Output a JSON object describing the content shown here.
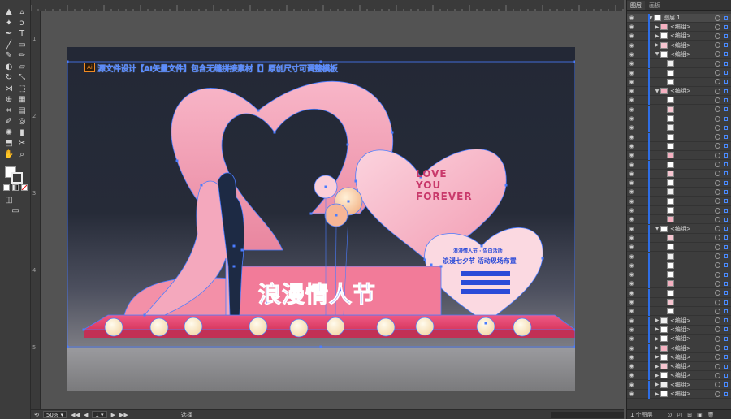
{
  "colors": {
    "accent": "#2e6ee6",
    "heart_pink": "#f4a3b8",
    "stage_pink": "#f0608a",
    "selection_blue": "#4a7cff",
    "artboard_dark": "#232836"
  },
  "toolbar": {
    "tools": [
      {
        "name": "selection-tool-icon",
        "glyph": "▲"
      },
      {
        "name": "direct-selection-tool-icon",
        "glyph": "▵"
      },
      {
        "name": "magic-wand-tool-icon",
        "glyph": "✦"
      },
      {
        "name": "lasso-tool-icon",
        "glyph": "ↄ"
      },
      {
        "name": "pen-tool-icon",
        "glyph": "✒"
      },
      {
        "name": "type-tool-icon",
        "glyph": "T"
      },
      {
        "name": "line-tool-icon",
        "glyph": "╱"
      },
      {
        "name": "rectangle-tool-icon",
        "glyph": "▭"
      },
      {
        "name": "paintbrush-tool-icon",
        "glyph": "✎"
      },
      {
        "name": "pencil-tool-icon",
        "glyph": "✏"
      },
      {
        "name": "blob-brush-tool-icon",
        "glyph": "◐"
      },
      {
        "name": "eraser-tool-icon",
        "glyph": "▱"
      },
      {
        "name": "rotate-tool-icon",
        "glyph": "↻"
      },
      {
        "name": "scale-tool-icon",
        "glyph": "⤡"
      },
      {
        "name": "width-tool-icon",
        "glyph": "⋈"
      },
      {
        "name": "free-transform-tool-icon",
        "glyph": "⬚"
      },
      {
        "name": "shape-builder-tool-icon",
        "glyph": "⊕"
      },
      {
        "name": "perspective-grid-tool-icon",
        "glyph": "▦"
      },
      {
        "name": "mesh-tool-icon",
        "glyph": "⌗"
      },
      {
        "name": "gradient-tool-icon",
        "glyph": "▤"
      },
      {
        "name": "eyedropper-tool-icon",
        "glyph": "✐"
      },
      {
        "name": "blend-tool-icon",
        "glyph": "◎"
      },
      {
        "name": "symbol-sprayer-tool-icon",
        "glyph": "✺"
      },
      {
        "name": "column-graph-tool-icon",
        "glyph": "▮"
      },
      {
        "name": "artboard-tool-icon",
        "glyph": "⬒"
      },
      {
        "name": "slice-tool-icon",
        "glyph": "✂"
      },
      {
        "name": "hand-tool-icon",
        "glyph": "✋"
      },
      {
        "name": "zoom-tool-icon",
        "glyph": "⌕"
      }
    ]
  },
  "ruler": {
    "top": [
      "",
      "",
      "",
      "",
      "",
      "",
      "",
      "",
      "",
      ""
    ],
    "left": [
      "1",
      "2",
      "3",
      "4",
      "5"
    ]
  },
  "artwork": {
    "header_text": "源文件设计【AI矢量文件】包含无缝拼接素材【】原创尺寸可调整模板",
    "ai_badge": "Ai",
    "title": "浪漫情人节",
    "love_lines": [
      "LOVE",
      "YOU",
      "FOREVER"
    ],
    "small_heart_title": "浪漫情人节 · 告白活动",
    "small_heart_subtitle": "浪漫七夕节  活动现场布置",
    "list_items": [
      "",
      "",
      ""
    ]
  },
  "statusbar": {
    "zoom": "50%",
    "artboard": "1",
    "tool_label": "选择"
  },
  "layers_panel": {
    "tabs": [
      "图层",
      "画板"
    ],
    "top_layer": "图层 1",
    "rows": [
      {
        "label": "<编组>",
        "indent": 0,
        "open": false
      },
      {
        "label": "<编组>",
        "indent": 0,
        "open": false
      },
      {
        "label": "<编组>",
        "indent": 0,
        "open": false
      },
      {
        "label": "<编组>",
        "indent": 0,
        "open": true
      },
      {
        "label": "",
        "indent": 1,
        "open": false
      },
      {
        "label": "",
        "indent": 1,
        "open": false
      },
      {
        "label": "",
        "indent": 1,
        "open": false
      },
      {
        "label": "<编组>",
        "indent": 0,
        "open": true
      },
      {
        "label": "",
        "indent": 1,
        "open": false
      },
      {
        "label": "",
        "indent": 1,
        "open": false
      },
      {
        "label": "",
        "indent": 1,
        "open": false
      },
      {
        "label": "",
        "indent": 1,
        "open": false
      },
      {
        "label": "",
        "indent": 1,
        "open": false
      },
      {
        "label": "",
        "indent": 1,
        "open": false
      },
      {
        "label": "",
        "indent": 1,
        "open": false
      },
      {
        "label": "",
        "indent": 1,
        "open": false
      },
      {
        "label": "",
        "indent": 1,
        "open": false
      },
      {
        "label": "",
        "indent": 1,
        "open": false
      },
      {
        "label": "",
        "indent": 1,
        "open": false
      },
      {
        "label": "",
        "indent": 1,
        "open": false
      },
      {
        "label": "",
        "indent": 1,
        "open": false
      },
      {
        "label": "",
        "indent": 1,
        "open": false
      },
      {
        "label": "<编组>",
        "indent": 0,
        "open": true
      },
      {
        "label": "",
        "indent": 1,
        "open": false
      },
      {
        "label": "",
        "indent": 1,
        "open": false
      },
      {
        "label": "",
        "indent": 1,
        "open": false
      },
      {
        "label": "",
        "indent": 1,
        "open": false
      },
      {
        "label": "",
        "indent": 1,
        "open": false
      },
      {
        "label": "",
        "indent": 1,
        "open": false
      },
      {
        "label": "",
        "indent": 1,
        "open": false
      },
      {
        "label": "",
        "indent": 1,
        "open": false
      },
      {
        "label": "",
        "indent": 1,
        "open": false
      },
      {
        "label": "<编组>",
        "indent": 0,
        "open": false
      },
      {
        "label": "<编组>",
        "indent": 0,
        "open": false
      },
      {
        "label": "<编组>",
        "indent": 0,
        "open": false
      },
      {
        "label": "<编组>",
        "indent": 0,
        "open": false
      },
      {
        "label": "<编组>",
        "indent": 0,
        "open": false
      },
      {
        "label": "<编组>",
        "indent": 0,
        "open": false
      },
      {
        "label": "<编组>",
        "indent": 0,
        "open": false
      },
      {
        "label": "<编组>",
        "indent": 0,
        "open": false
      },
      {
        "label": "<编组>",
        "indent": 0,
        "open": false
      }
    ],
    "footer": "1 个图层"
  }
}
